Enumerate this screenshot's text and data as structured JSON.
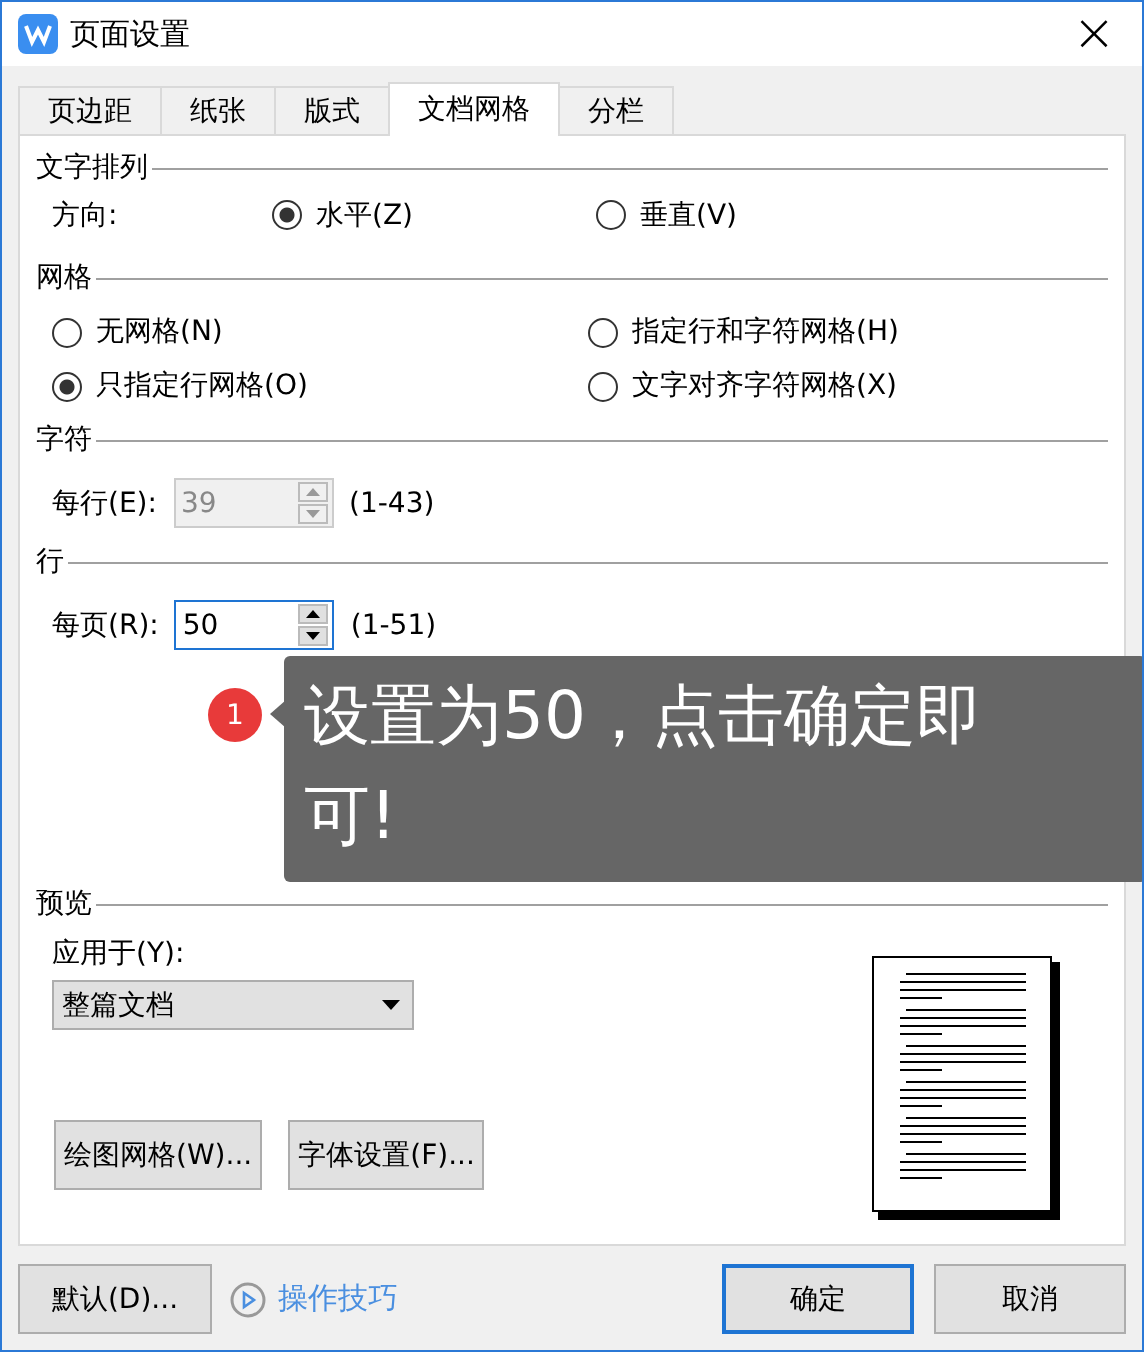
{
  "window": {
    "title": "页面设置",
    "close": "×"
  },
  "tabs": [
    {
      "label": "页边距",
      "selected": false
    },
    {
      "label": "纸张",
      "selected": false
    },
    {
      "label": "版式",
      "selected": false
    },
    {
      "label": "文档网格",
      "selected": true
    },
    {
      "label": "分栏",
      "selected": false
    }
  ],
  "text_direction": {
    "title": "文字排列",
    "label": "方向:",
    "options": [
      {
        "label": "水平(Z)",
        "selected": true
      },
      {
        "label": "垂直(V)",
        "selected": false
      }
    ]
  },
  "grid": {
    "title": "网格",
    "options": [
      {
        "label": "无网格(N)",
        "selected": false
      },
      {
        "label": "指定行和字符网格(H)",
        "selected": false
      },
      {
        "label": "只指定行网格(O)",
        "selected": true
      },
      {
        "label": "文字对齐字符网格(X)",
        "selected": false
      }
    ]
  },
  "characters": {
    "title": "字符",
    "label": "每行(E):",
    "value": "39",
    "range": "(1-43)",
    "disabled": true
  },
  "lines": {
    "title": "行",
    "label": "每页(R):",
    "value": "50",
    "range": "(1-51)",
    "disabled": false
  },
  "preview": {
    "title": "预览",
    "apply_label": "应用于(Y):",
    "apply_value": "整篇文档",
    "buttons": [
      "绘图网格(W)...",
      "字体设置(F)..."
    ]
  },
  "tooltip": {
    "badge": "1",
    "text": "设置为50，点击确定即可!"
  },
  "footer": {
    "default_button": "默认(D)...",
    "help_link": "操作技巧",
    "ok": "确定",
    "cancel": "取消"
  }
}
